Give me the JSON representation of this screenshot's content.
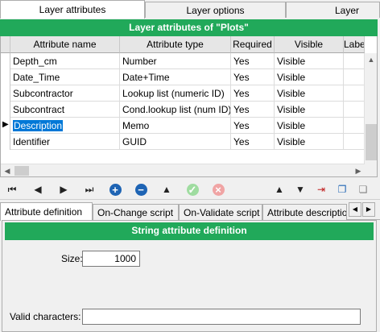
{
  "top_tabs": [
    "Layer attributes",
    "Layer options",
    "Layer"
  ],
  "grid_title": "Layer attributes of \"Plots\"",
  "columns": [
    "Attribute name",
    "Attribute type",
    "Required",
    "Visible",
    "Label"
  ],
  "rows": [
    {
      "name": "Depth_cm",
      "type": "Number",
      "required": "Yes",
      "visible": "Visible"
    },
    {
      "name": "Date_Time",
      "type": "Date+Time",
      "required": "Yes",
      "visible": "Visible"
    },
    {
      "name": "Subcontractor",
      "type": "Lookup list (numeric ID)",
      "required": "Yes",
      "visible": "Visible"
    },
    {
      "name": "Subcontract",
      "type": "Cond.lookup list (num ID)",
      "required": "Yes",
      "visible": "Visible"
    },
    {
      "name": "Description",
      "type": "Memo",
      "required": "Yes",
      "visible": "Visible"
    },
    {
      "name": "Identifier",
      "type": "GUID",
      "required": "Yes",
      "visible": "Visible"
    }
  ],
  "lower_tabs": [
    "Attribute definition",
    "On-Change script",
    "On-Validate script",
    "Attribute description"
  ],
  "section_title": "String attribute definition",
  "size_label": "Size:",
  "size_value": "1000",
  "valid_chars_label": "Valid characters:",
  "valid_chars_value": ""
}
